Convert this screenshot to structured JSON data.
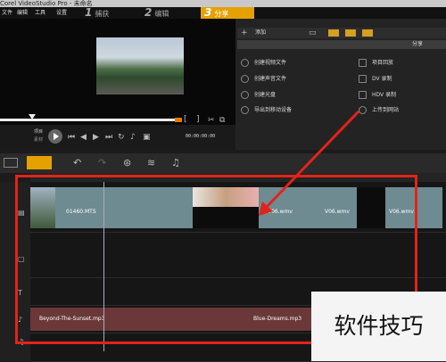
{
  "window": {
    "title": "Corel VideoStudio Pro - 未命名"
  },
  "menu": [
    "文件",
    "编辑",
    "工具",
    "设置"
  ],
  "steps": [
    {
      "num": "1",
      "label": "捕获"
    },
    {
      "num": "2",
      "label": "编辑"
    },
    {
      "num": "3",
      "label": "分享"
    }
  ],
  "player": {
    "mode_labels": [
      "项目",
      "素材"
    ],
    "timecode": "00:00:00:00"
  },
  "share_panel": {
    "add_label": "添加",
    "header": "分享",
    "left_options": [
      "创建视频文件",
      "创建声音文件",
      "创建光盘",
      "导出到移动设备"
    ],
    "right_options": [
      "项目回放",
      "DV 录制",
      "HDV 录制",
      "上传到网站"
    ]
  },
  "timeline": {
    "video_clips": [
      "01460.MTS",
      "V06.wmv",
      "V06.wmv",
      "V06.wmv"
    ],
    "audio_clips": [
      "Beyond-The-Sunset.mp3",
      "Blue-Dreams.mp3"
    ]
  },
  "watermark": {
    "text": "软件技巧"
  },
  "colors": {
    "accent": "#e5a100",
    "highlight": "#e2231a",
    "clip": "#6e8b92",
    "audio_clip": "#6a3838"
  }
}
